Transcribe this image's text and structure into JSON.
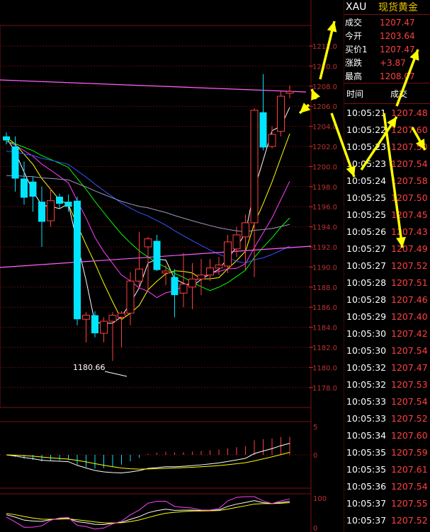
{
  "quote": {
    "symbol": "XAU",
    "name": "现货黄金",
    "rows": [
      {
        "label": "成交",
        "value": "1207.47"
      },
      {
        "label": "今开",
        "value": "1203.64"
      },
      {
        "label": "买价1",
        "value": "1207.47"
      },
      {
        "label": "涨跌",
        "value": "+3.87"
      },
      {
        "label": "最高",
        "value": "1208.07"
      }
    ]
  },
  "ticks": {
    "header_time": "时间",
    "header_price": "成交",
    "rows": [
      {
        "time": "10:05:21",
        "price": "1207.48"
      },
      {
        "time": "10:05:22",
        "price": "1207.60"
      },
      {
        "time": "10:05:23",
        "price": "1207.50"
      },
      {
        "time": "10:05:23",
        "price": "1207.54"
      },
      {
        "time": "10:05:24",
        "price": "1207.58"
      },
      {
        "time": "10:05:25",
        "price": "1207.50"
      },
      {
        "time": "10:05:25",
        "price": "1207.45"
      },
      {
        "time": "10:05:26",
        "price": "1207.43"
      },
      {
        "time": "10:05:27",
        "price": "1207.49"
      },
      {
        "time": "10:05:27",
        "price": "1207.52"
      },
      {
        "time": "10:05:28",
        "price": "1207.51"
      },
      {
        "time": "10:05:28",
        "price": "1207.46"
      },
      {
        "time": "10:05:29",
        "price": "1207.40"
      },
      {
        "time": "10:05:30",
        "price": "1207.42"
      },
      {
        "time": "10:05:30",
        "price": "1207.54"
      },
      {
        "time": "10:05:32",
        "price": "1207.47"
      },
      {
        "time": "10:05:32",
        "price": "1207.53"
      },
      {
        "time": "10:05:33",
        "price": "1207.54"
      },
      {
        "time": "10:05:33",
        "price": "1207.52"
      },
      {
        "time": "10:05:34",
        "price": "1207.60"
      },
      {
        "time": "10:05:35",
        "price": "1207.59"
      },
      {
        "time": "10:05:35",
        "price": "1207.61"
      },
      {
        "time": "10:05:36",
        "price": "1207.54"
      },
      {
        "time": "10:05:37",
        "price": "1207.55"
      },
      {
        "time": "10:05:37",
        "price": "1207.52"
      }
    ]
  },
  "main_axis": {
    "labels": [
      "1212.0",
      "1210.0",
      "1208.0",
      "1206.0",
      "1204.0",
      "1202.0",
      "1200.0",
      "1198.0",
      "1196.0",
      "1194.0",
      "1192.0",
      "1190.0",
      "1188.0",
      "1186.0",
      "1184.0",
      "1182.0",
      "1180.0",
      "1178.0"
    ]
  },
  "annotations": {
    "low_label": "1180.66"
  },
  "macd_axis": {
    "top": "5",
    "zero": "0"
  },
  "kdj_axis": {
    "top": "100",
    "bottom": "0"
  },
  "colors": {
    "up": "#ff4040",
    "down": "#00e5ff",
    "ma1": "#ffffff",
    "ma2": "#ffff00",
    "ma3": "#ff40ff",
    "ma4": "#00ff00",
    "ma5": "#3355ff",
    "ma6": "#9a9aba",
    "trend": "#ff60ff",
    "arrow": "#ffff00"
  },
  "candles": [
    {
      "o": 1203.0,
      "h": 1203.4,
      "l": 1202.2,
      "c": 1202.6
    },
    {
      "o": 1202.0,
      "h": 1203.0,
      "l": 1197.5,
      "c": 1198.8
    },
    {
      "o": 1198.8,
      "h": 1200.5,
      "l": 1196.2,
      "c": 1196.9
    },
    {
      "o": 1198.5,
      "h": 1199.0,
      "l": 1195.5,
      "c": 1197.0
    },
    {
      "o": 1196.5,
      "h": 1198.0,
      "l": 1192.0,
      "c": 1194.5
    },
    {
      "o": 1194.6,
      "h": 1197.8,
      "l": 1194.0,
      "c": 1196.6
    },
    {
      "o": 1197.0,
      "h": 1197.3,
      "l": 1195.8,
      "c": 1196.3
    },
    {
      "o": 1196.5,
      "h": 1197.2,
      "l": 1195.5,
      "c": 1196.0
    },
    {
      "o": 1196.6,
      "h": 1197.0,
      "l": 1184.2,
      "c": 1184.8
    },
    {
      "o": 1184.8,
      "h": 1185.5,
      "l": 1182.5,
      "c": 1185.2
    },
    {
      "o": 1185.2,
      "h": 1185.6,
      "l": 1183.0,
      "c": 1183.4
    },
    {
      "o": 1183.4,
      "h": 1185.0,
      "l": 1182.5,
      "c": 1184.6
    },
    {
      "o": 1184.6,
      "h": 1185.5,
      "l": 1180.66,
      "c": 1185.2
    },
    {
      "o": 1185.0,
      "h": 1185.6,
      "l": 1182.0,
      "c": 1185.4
    },
    {
      "o": 1185.4,
      "h": 1189.5,
      "l": 1184.2,
      "c": 1188.6
    },
    {
      "o": 1188.6,
      "h": 1193.5,
      "l": 1187.8,
      "c": 1189.8
    },
    {
      "o": 1192.0,
      "h": 1193.0,
      "l": 1187.5,
      "c": 1192.8
    },
    {
      "o": 1192.6,
      "h": 1193.2,
      "l": 1189.6,
      "c": 1189.7
    },
    {
      "o": 1189.4,
      "h": 1190.2,
      "l": 1188.2,
      "c": 1189.6
    },
    {
      "o": 1189.0,
      "h": 1189.8,
      "l": 1185.0,
      "c": 1187.2
    },
    {
      "o": 1187.4,
      "h": 1191.4,
      "l": 1186.0,
      "c": 1188.3
    },
    {
      "o": 1188.0,
      "h": 1190.4,
      "l": 1185.8,
      "c": 1188.8
    },
    {
      "o": 1188.8,
      "h": 1190.8,
      "l": 1187.2,
      "c": 1189.2
    },
    {
      "o": 1189.2,
      "h": 1190.8,
      "l": 1188.6,
      "c": 1189.9
    },
    {
      "o": 1189.9,
      "h": 1191.0,
      "l": 1189.2,
      "c": 1190.2
    },
    {
      "o": 1190.1,
      "h": 1193.2,
      "l": 1189.4,
      "c": 1192.5
    },
    {
      "o": 1191.8,
      "h": 1194.0,
      "l": 1191.0,
      "c": 1193.2
    },
    {
      "o": 1193.0,
      "h": 1195.2,
      "l": 1189.7,
      "c": 1194.4
    },
    {
      "o": 1194.4,
      "h": 1205.8,
      "l": 1189.0,
      "c": 1205.6
    },
    {
      "o": 1205.4,
      "h": 1209.2,
      "l": 1201.6,
      "c": 1201.9
    },
    {
      "o": 1202.0,
      "h": 1204.0,
      "l": 1201.8,
      "c": 1203.2
    },
    {
      "o": 1203.5,
      "h": 1207.5,
      "l": 1203.0,
      "c": 1207.0
    },
    {
      "o": 1207.3,
      "h": 1208.07,
      "l": 1206.8,
      "c": 1207.47
    }
  ]
}
